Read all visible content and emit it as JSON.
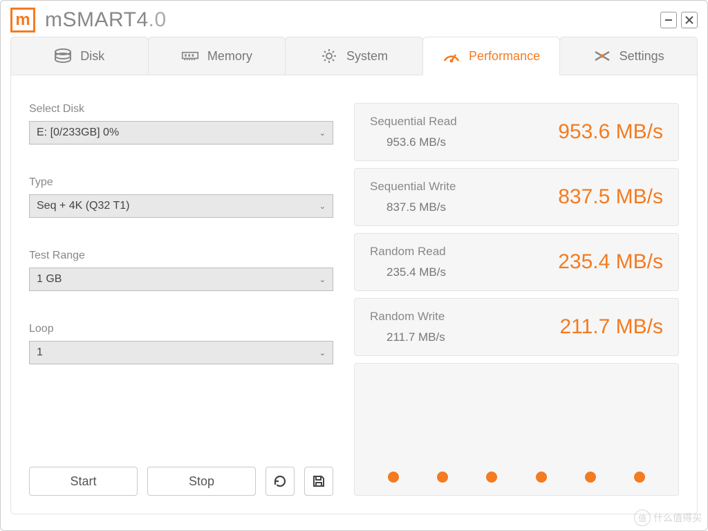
{
  "app": {
    "title_main": "mSMART4",
    "title_suffix": ".0"
  },
  "tabs": {
    "disk": "Disk",
    "memory": "Memory",
    "system": "System",
    "performance": "Performance",
    "settings": "Settings"
  },
  "form": {
    "select_disk_label": "Select Disk",
    "select_disk_value": "E: [0/233GB] 0%",
    "type_label": "Type",
    "type_value": "Seq + 4K (Q32 T1)",
    "range_label": "Test Range",
    "range_value": "1 GB",
    "loop_label": "Loop",
    "loop_value": "1",
    "start": "Start",
    "stop": "Stop"
  },
  "results": {
    "seq_read": {
      "name": "Sequential Read",
      "value": "953.6 MB/s",
      "sub": "953.6 MB/s"
    },
    "seq_write": {
      "name": "Sequential Write",
      "value": "837.5 MB/s",
      "sub": "837.5 MB/s"
    },
    "rnd_read": {
      "name": "Random Read",
      "value": "235.4 MB/s",
      "sub": "235.4 MB/s"
    },
    "rnd_write": {
      "name": "Random Write",
      "value": "211.7 MB/s",
      "sub": "211.7 MB/s"
    }
  },
  "watermark": "什么值得买",
  "colors": {
    "accent": "#f47b20"
  }
}
